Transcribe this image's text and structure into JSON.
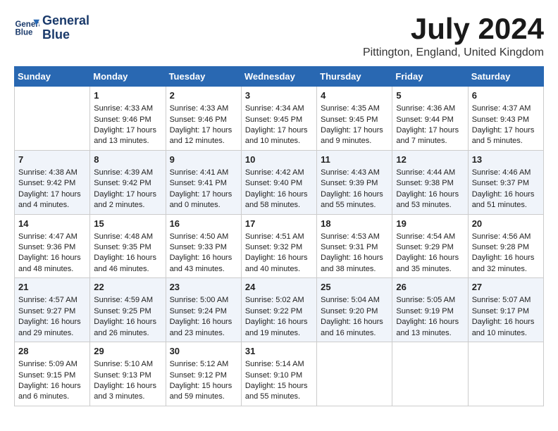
{
  "header": {
    "logo_line1": "General",
    "logo_line2": "Blue",
    "month": "July 2024",
    "location": "Pittington, England, United Kingdom"
  },
  "days_of_week": [
    "Sunday",
    "Monday",
    "Tuesday",
    "Wednesday",
    "Thursday",
    "Friday",
    "Saturday"
  ],
  "weeks": [
    [
      {
        "day": "",
        "sunrise": "",
        "sunset": "",
        "daylight": ""
      },
      {
        "day": "1",
        "sunrise": "Sunrise: 4:33 AM",
        "sunset": "Sunset: 9:46 PM",
        "daylight": "Daylight: 17 hours and 13 minutes."
      },
      {
        "day": "2",
        "sunrise": "Sunrise: 4:33 AM",
        "sunset": "Sunset: 9:46 PM",
        "daylight": "Daylight: 17 hours and 12 minutes."
      },
      {
        "day": "3",
        "sunrise": "Sunrise: 4:34 AM",
        "sunset": "Sunset: 9:45 PM",
        "daylight": "Daylight: 17 hours and 10 minutes."
      },
      {
        "day": "4",
        "sunrise": "Sunrise: 4:35 AM",
        "sunset": "Sunset: 9:45 PM",
        "daylight": "Daylight: 17 hours and 9 minutes."
      },
      {
        "day": "5",
        "sunrise": "Sunrise: 4:36 AM",
        "sunset": "Sunset: 9:44 PM",
        "daylight": "Daylight: 17 hours and 7 minutes."
      },
      {
        "day": "6",
        "sunrise": "Sunrise: 4:37 AM",
        "sunset": "Sunset: 9:43 PM",
        "daylight": "Daylight: 17 hours and 5 minutes."
      }
    ],
    [
      {
        "day": "7",
        "sunrise": "Sunrise: 4:38 AM",
        "sunset": "Sunset: 9:42 PM",
        "daylight": "Daylight: 17 hours and 4 minutes."
      },
      {
        "day": "8",
        "sunrise": "Sunrise: 4:39 AM",
        "sunset": "Sunset: 9:42 PM",
        "daylight": "Daylight: 17 hours and 2 minutes."
      },
      {
        "day": "9",
        "sunrise": "Sunrise: 4:41 AM",
        "sunset": "Sunset: 9:41 PM",
        "daylight": "Daylight: 17 hours and 0 minutes."
      },
      {
        "day": "10",
        "sunrise": "Sunrise: 4:42 AM",
        "sunset": "Sunset: 9:40 PM",
        "daylight": "Daylight: 16 hours and 58 minutes."
      },
      {
        "day": "11",
        "sunrise": "Sunrise: 4:43 AM",
        "sunset": "Sunset: 9:39 PM",
        "daylight": "Daylight: 16 hours and 55 minutes."
      },
      {
        "day": "12",
        "sunrise": "Sunrise: 4:44 AM",
        "sunset": "Sunset: 9:38 PM",
        "daylight": "Daylight: 16 hours and 53 minutes."
      },
      {
        "day": "13",
        "sunrise": "Sunrise: 4:46 AM",
        "sunset": "Sunset: 9:37 PM",
        "daylight": "Daylight: 16 hours and 51 minutes."
      }
    ],
    [
      {
        "day": "14",
        "sunrise": "Sunrise: 4:47 AM",
        "sunset": "Sunset: 9:36 PM",
        "daylight": "Daylight: 16 hours and 48 minutes."
      },
      {
        "day": "15",
        "sunrise": "Sunrise: 4:48 AM",
        "sunset": "Sunset: 9:35 PM",
        "daylight": "Daylight: 16 hours and 46 minutes."
      },
      {
        "day": "16",
        "sunrise": "Sunrise: 4:50 AM",
        "sunset": "Sunset: 9:33 PM",
        "daylight": "Daylight: 16 hours and 43 minutes."
      },
      {
        "day": "17",
        "sunrise": "Sunrise: 4:51 AM",
        "sunset": "Sunset: 9:32 PM",
        "daylight": "Daylight: 16 hours and 40 minutes."
      },
      {
        "day": "18",
        "sunrise": "Sunrise: 4:53 AM",
        "sunset": "Sunset: 9:31 PM",
        "daylight": "Daylight: 16 hours and 38 minutes."
      },
      {
        "day": "19",
        "sunrise": "Sunrise: 4:54 AM",
        "sunset": "Sunset: 9:29 PM",
        "daylight": "Daylight: 16 hours and 35 minutes."
      },
      {
        "day": "20",
        "sunrise": "Sunrise: 4:56 AM",
        "sunset": "Sunset: 9:28 PM",
        "daylight": "Daylight: 16 hours and 32 minutes."
      }
    ],
    [
      {
        "day": "21",
        "sunrise": "Sunrise: 4:57 AM",
        "sunset": "Sunset: 9:27 PM",
        "daylight": "Daylight: 16 hours and 29 minutes."
      },
      {
        "day": "22",
        "sunrise": "Sunrise: 4:59 AM",
        "sunset": "Sunset: 9:25 PM",
        "daylight": "Daylight: 16 hours and 26 minutes."
      },
      {
        "day": "23",
        "sunrise": "Sunrise: 5:00 AM",
        "sunset": "Sunset: 9:24 PM",
        "daylight": "Daylight: 16 hours and 23 minutes."
      },
      {
        "day": "24",
        "sunrise": "Sunrise: 5:02 AM",
        "sunset": "Sunset: 9:22 PM",
        "daylight": "Daylight: 16 hours and 19 minutes."
      },
      {
        "day": "25",
        "sunrise": "Sunrise: 5:04 AM",
        "sunset": "Sunset: 9:20 PM",
        "daylight": "Daylight: 16 hours and 16 minutes."
      },
      {
        "day": "26",
        "sunrise": "Sunrise: 5:05 AM",
        "sunset": "Sunset: 9:19 PM",
        "daylight": "Daylight: 16 hours and 13 minutes."
      },
      {
        "day": "27",
        "sunrise": "Sunrise: 5:07 AM",
        "sunset": "Sunset: 9:17 PM",
        "daylight": "Daylight: 16 hours and 10 minutes."
      }
    ],
    [
      {
        "day": "28",
        "sunrise": "Sunrise: 5:09 AM",
        "sunset": "Sunset: 9:15 PM",
        "daylight": "Daylight: 16 hours and 6 minutes."
      },
      {
        "day": "29",
        "sunrise": "Sunrise: 5:10 AM",
        "sunset": "Sunset: 9:13 PM",
        "daylight": "Daylight: 16 hours and 3 minutes."
      },
      {
        "day": "30",
        "sunrise": "Sunrise: 5:12 AM",
        "sunset": "Sunset: 9:12 PM",
        "daylight": "Daylight: 15 hours and 59 minutes."
      },
      {
        "day": "31",
        "sunrise": "Sunrise: 5:14 AM",
        "sunset": "Sunset: 9:10 PM",
        "daylight": "Daylight: 15 hours and 55 minutes."
      },
      {
        "day": "",
        "sunrise": "",
        "sunset": "",
        "daylight": ""
      },
      {
        "day": "",
        "sunrise": "",
        "sunset": "",
        "daylight": ""
      },
      {
        "day": "",
        "sunrise": "",
        "sunset": "",
        "daylight": ""
      }
    ]
  ]
}
